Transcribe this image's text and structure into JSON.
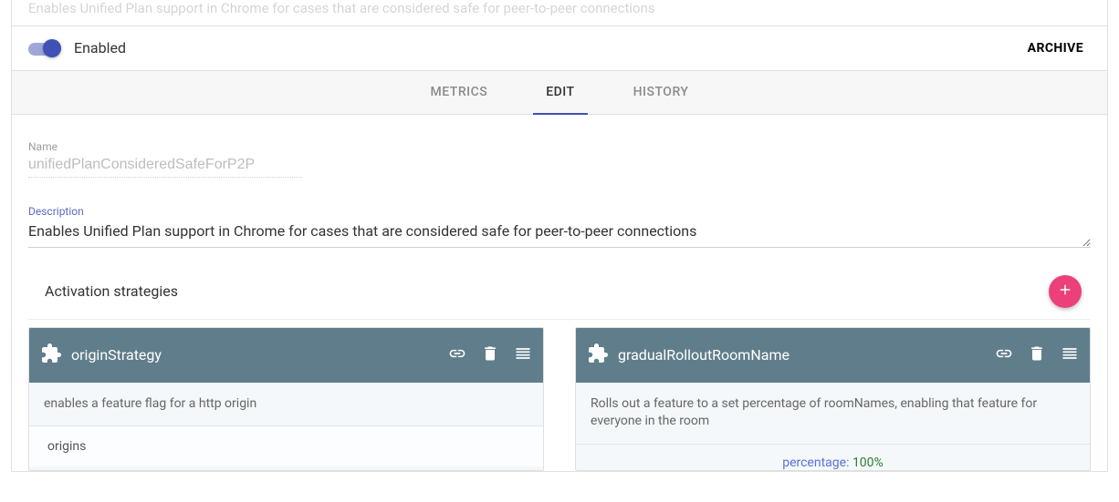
{
  "faded_header_text": "Enables Unified Plan support in Chrome for cases that are considered safe for peer-to-peer connections",
  "toggle": {
    "enabled_label": "Enabled",
    "state": true
  },
  "archive_label": "ARCHIVE",
  "tabs": {
    "metrics": "METRICS",
    "edit": "EDIT",
    "history": "HISTORY",
    "active": "edit"
  },
  "form": {
    "name_label": "Name",
    "name_value": "unifiedPlanConsideredSafeForP2P",
    "description_label": "Description",
    "description_value": "Enables Unified Plan support in Chrome for cases that are considered safe for peer-to-peer connections"
  },
  "strategies": {
    "heading": "Activation strategies",
    "items": [
      {
        "title": "originStrategy",
        "desc": "enables a feature flag for a http origin",
        "body_label": "origins"
      },
      {
        "title": "gradualRolloutRoomName",
        "desc": "Rolls out a feature to a set percentage of roomNames, enabling that feature for everyone in the room",
        "percentage_label": "percentage: ",
        "percentage_value": "100%"
      }
    ]
  }
}
